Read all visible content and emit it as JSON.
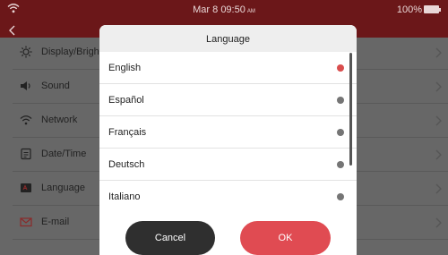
{
  "status_bar": {
    "time": "Mar 8 09:50",
    "ampm": "AM",
    "battery": "100%"
  },
  "settings": {
    "items": [
      {
        "label": "Display/Brightness",
        "icon": "brightness-icon"
      },
      {
        "label": "Sound",
        "icon": "speaker-icon"
      },
      {
        "label": "Network",
        "icon": "wifi-icon"
      },
      {
        "label": "Date/Time",
        "icon": "calendar-icon"
      },
      {
        "label": "Language",
        "icon": "language-icon"
      },
      {
        "label": "E-mail",
        "icon": "mail-icon"
      }
    ]
  },
  "dialog": {
    "title": "Language",
    "languages": [
      {
        "label": "English",
        "selected": true
      },
      {
        "label": "Español",
        "selected": false
      },
      {
        "label": "Français",
        "selected": false
      },
      {
        "label": "Deutsch",
        "selected": false
      },
      {
        "label": "Italiano",
        "selected": false
      }
    ],
    "cancel_label": "Cancel",
    "ok_label": "OK"
  },
  "colors": {
    "header_bg": "#6b1719",
    "selected_radio": "#d94d4d",
    "ok_button": "#e04b52",
    "cancel_button": "#2f2f2f"
  }
}
